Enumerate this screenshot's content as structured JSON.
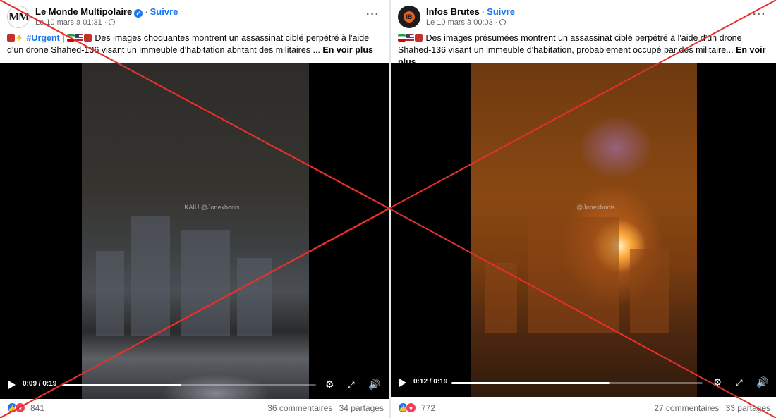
{
  "posts": [
    {
      "page_name": "Le Monde Multipolaire",
      "avatar_text": "MM",
      "follow_label": "Suivre",
      "timestamp": "Le 10 mars à 01:31 ·",
      "hashtag": "#Urgent",
      "caption_line1": " | ",
      "caption_text": " Des images choquantes montrent un assassinat ciblé perpétré à l'aide d'un drone Shahed-136 visant un immeuble d'habitation abritant des militaires ... ",
      "see_more": "En voir plus",
      "watermark": "KAIU @Jonexbonis",
      "time_display": "0:09 / 0:19",
      "progress": 0.47,
      "reaction_count": "841",
      "comments": "36 commentaires",
      "shares": "34 partages"
    },
    {
      "page_name": "Infos Brutes",
      "avatar_text": "IB",
      "follow_label": "Suivre",
      "timestamp": "Le 10 mars à 00:03 ·",
      "caption_text": " Des images présumées montrent un assassinat ciblé perpétré à l'aide d'un drone Shahed-136 visant un immeuble d'habitation, probablement occupé par des militaire... ",
      "see_more": "En voir plus",
      "watermark": "@Jonexbonis",
      "time_display": "0:12 / 0:19",
      "progress": 0.63,
      "reaction_count": "772",
      "comments": "27 commentaires",
      "shares": "33 partages"
    }
  ],
  "ui": {
    "more_icon": "···"
  },
  "colors": {
    "fb_blue": "#1877f2",
    "cross_red": "#e8302a"
  }
}
